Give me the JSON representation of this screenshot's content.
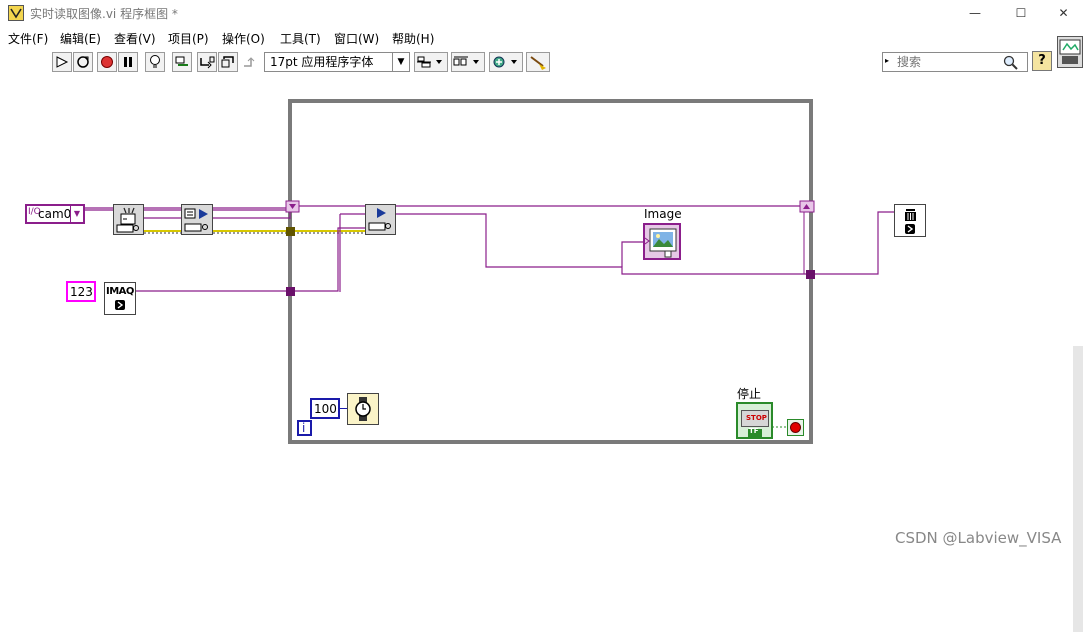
{
  "window": {
    "title": "实时读取图像.vi 程序框图 *",
    "minimize_glyph": "—",
    "maximize_glyph": "☐",
    "close_glyph": "✕"
  },
  "menu": [
    "文件(F)",
    "编辑(E)",
    "查看(V)",
    "项目(P)",
    "操作(O)",
    "工具(T)",
    "窗口(W)",
    "帮助(H)"
  ],
  "toolbar": {
    "font_select": "17pt 应用程序字体",
    "search_placeholder": "搜索"
  },
  "diagram": {
    "camera_constant": "cam0",
    "session_constant": "123",
    "imaq_label": "IMAQ",
    "image_indicator_label": "Image",
    "wait_ms_constant": "100",
    "iteration_terminal": "i",
    "stop_label": "停止",
    "stop_button_text": "STOP",
    "stop_tf": "TF"
  },
  "colors": {
    "wire_purple": "#8b1e8b",
    "wire_yellow": "#d8c800",
    "loop_border": "#7a7a7a",
    "session_pink": "#ff00ff",
    "numeric_blue": "#1a1aaa",
    "bool_green": "#2a8a2a"
  },
  "watermark": "CSDN @Labview_VISA"
}
